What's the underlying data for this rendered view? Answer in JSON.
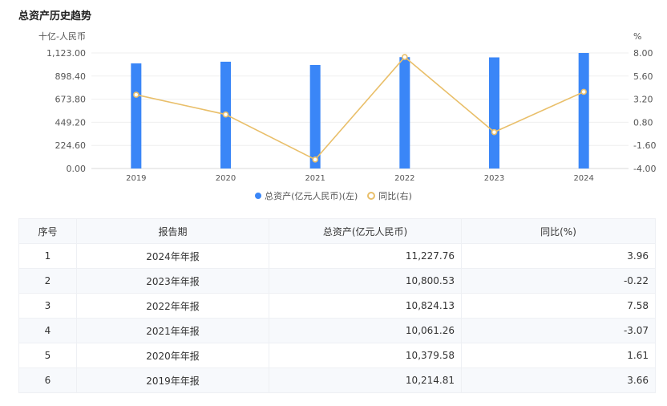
{
  "page_title": "总资产历史趋势",
  "chart_data": {
    "type": "bar+line",
    "categories": [
      "2019",
      "2020",
      "2021",
      "2022",
      "2023",
      "2024"
    ],
    "series": [
      {
        "name": "总资产(亿元人民币)(左)",
        "type": "bar",
        "axis": "left",
        "unit": "十亿-人民币",
        "values": [
          1021.481,
          1037.958,
          1006.126,
          1082.413,
          1080.053,
          1122.776
        ]
      },
      {
        "name": "同比(右)",
        "type": "line",
        "axis": "right",
        "unit": "%",
        "values": [
          3.66,
          1.61,
          -3.07,
          7.58,
          -0.22,
          3.96
        ]
      }
    ],
    "left_axis": {
      "label": "十亿-人民币",
      "ticks": [
        "0.00",
        "224.60",
        "449.20",
        "673.80",
        "898.40",
        "1,123.00"
      ],
      "range": [
        0,
        1123
      ]
    },
    "right_axis": {
      "label": "%",
      "ticks": [
        "-4.00",
        "-1.60",
        "0.80",
        "3.20",
        "5.60",
        "8.00"
      ],
      "range": [
        -4,
        8
      ]
    },
    "legend_position": "bottom",
    "colors": {
      "bar": "#3a86f7",
      "line": "#e9bf6a"
    }
  },
  "table": {
    "headers": [
      "序号",
      "报告期",
      "总资产(亿元人民币)",
      "同比(%)"
    ],
    "rows": [
      [
        "1",
        "2024年年报",
        "11,227.76",
        "3.96"
      ],
      [
        "2",
        "2023年年报",
        "10,800.53",
        "-0.22"
      ],
      [
        "3",
        "2022年年报",
        "10,824.13",
        "7.58"
      ],
      [
        "4",
        "2021年年报",
        "10,061.26",
        "-3.07"
      ],
      [
        "5",
        "2020年年报",
        "10,379.58",
        "1.61"
      ],
      [
        "6",
        "2019年年报",
        "10,214.81",
        "3.66"
      ]
    ]
  }
}
